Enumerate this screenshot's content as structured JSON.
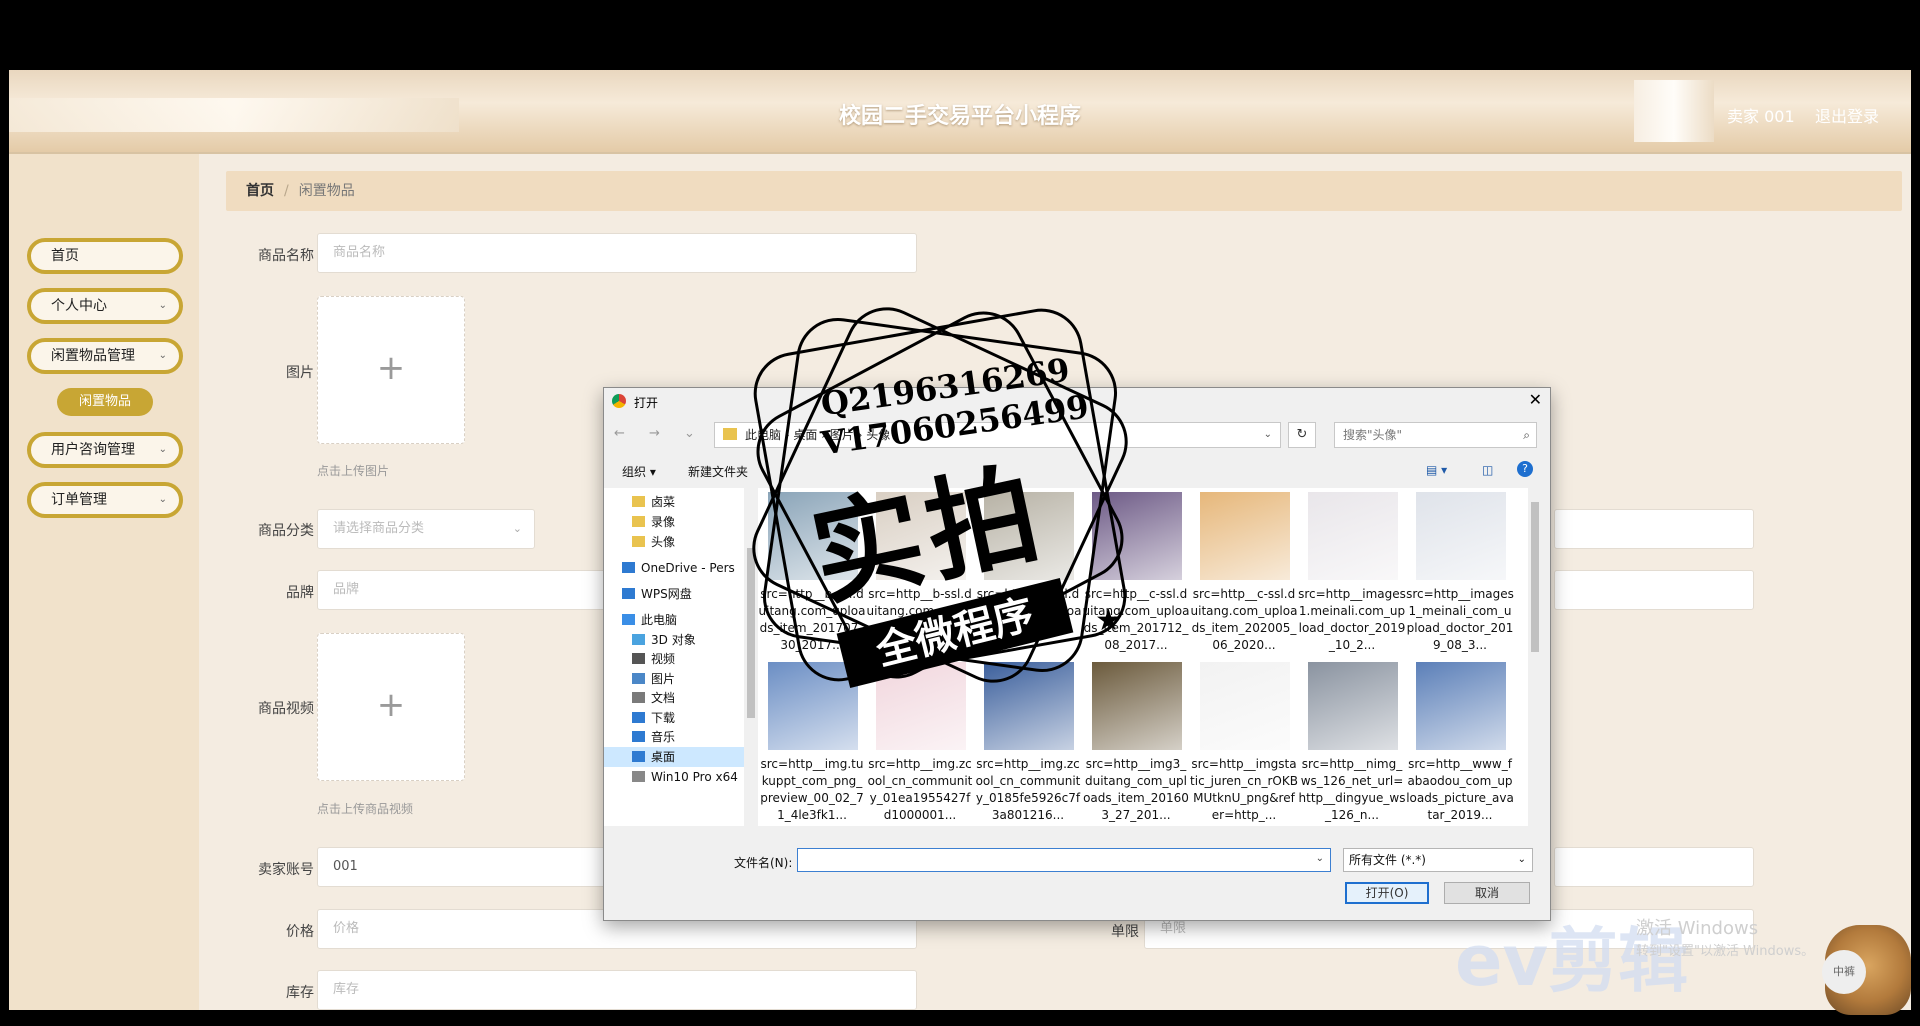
{
  "header": {
    "app_title": "校园二手交易平台小程序",
    "user": "卖家 001",
    "logout": "退出登录"
  },
  "sidebar": {
    "items": [
      {
        "label": "首页",
        "has_chevron": false
      },
      {
        "label": "个人中心",
        "has_chevron": true
      },
      {
        "label": "闲置物品管理",
        "has_chevron": true
      },
      {
        "label": "用户咨询管理",
        "has_chevron": true
      },
      {
        "label": "订单管理",
        "has_chevron": true
      }
    ],
    "active_sub": "闲置物品",
    "chevron": "⌄"
  },
  "breadcrumb": {
    "home": "首页",
    "sep": "/",
    "current": "闲置物品"
  },
  "form": {
    "name_label": "商品名称",
    "name_placeholder": "商品名称",
    "image_label": "图片",
    "image_hint": "点击上传图片",
    "category_label": "商品分类",
    "category_placeholder": "请选择商品分类",
    "brand_label": "品牌",
    "brand_placeholder": "品牌",
    "video_label": "商品视频",
    "video_hint": "点击上传商品视频",
    "seller_label": "卖家账号",
    "seller_value": "001",
    "price_label": "价格",
    "price_placeholder": "价格",
    "limit_label": "单限",
    "limit_placeholder": "单限",
    "stock_label": "库存",
    "stock_placeholder": "库存",
    "plus": "+"
  },
  "dialog": {
    "title": "打开",
    "close": "✕",
    "nav": "← → ⌄ ↑",
    "address": "此电脑 › 桌面 › 图片 › 头像",
    "refresh": "↻",
    "search_placeholder": "搜索\"头像\"",
    "organize": "组织 ▾",
    "new_folder": "新建文件夹",
    "help": "?",
    "tree": [
      {
        "label": "卤菜",
        "icon": "folder-icon"
      },
      {
        "label": "录像",
        "icon": "folder-icon"
      },
      {
        "label": "头像",
        "icon": "folder-icon"
      },
      {
        "label": "OneDrive - Pers",
        "icon": "cloud-icon"
      },
      {
        "label": "WPS网盘",
        "icon": "cloud-icon"
      },
      {
        "label": "此电脑",
        "icon": "pc-icon"
      },
      {
        "label": "3D 对象",
        "icon": "3d-icon"
      },
      {
        "label": "视频",
        "icon": "video-icon"
      },
      {
        "label": "图片",
        "icon": "picture-icon"
      },
      {
        "label": "文档",
        "icon": "document-icon"
      },
      {
        "label": "下载",
        "icon": "download-icon"
      },
      {
        "label": "音乐",
        "icon": "music-icon"
      },
      {
        "label": "桌面",
        "icon": "desktop-icon",
        "selected": true
      },
      {
        "label": "Win10 Pro x64",
        "icon": "drive-icon"
      }
    ],
    "files": [
      {
        "name": "src=http__b-ssl.duitang.com_uploads_item_201707_30_2017...",
        "color": "#8aa4b8"
      },
      {
        "name": "src=http__b-ssl.duitang.com_uploads_item_20...",
        "color": "#d9cfc3"
      },
      {
        "name": "src=http__c-ssl.duitang.com_uploads_item_20...",
        "color": "#b7b2a5"
      },
      {
        "name": "src=http__c-ssl.duitang.com_uploads_item_201712_08_2017...",
        "color": "#6d5a86"
      },
      {
        "name": "src=http__c-ssl.duitang.com_uploads_item_202005_06_2020...",
        "color": "#e6b77a"
      },
      {
        "name": "src=http__images1.meinali.com_upload_doctor_2019_10_2...",
        "color": "#e9e6ea"
      },
      {
        "name": "src=http__images1_meinali_com_upload_doctor_2019_08_3...",
        "color": "#dfe3ea"
      },
      {
        "name": "src=http__img.tukuppt_com_png_preview_00_02_71_4le3fk1...",
        "color": "#6b8ec4"
      },
      {
        "name": "src=http__img.zcool_cn_community_01ea1955427fd1000001...",
        "color": "#f1d6dd"
      },
      {
        "name": "src=http__img.zcool_cn_community_0185fe5926c7f3a801216...",
        "color": "#3b5f9c"
      },
      {
        "name": "src=http__img3_duitang_com_uploads_item_201603_27_201...",
        "color": "#6b5a3c"
      },
      {
        "name": "src=http__imgstatic_juren_cn_rOKBMUtknU_png&refer=http_...",
        "color": "#f2f2f2"
      },
      {
        "name": "src=http__nimg_ws_126_net_url=http__dingyue_ws_126_n...",
        "color": "#8a93a0"
      },
      {
        "name": "src=http__www_fabaodou_com_uploads_picture_avatar_2019...",
        "color": "#5b7fb8"
      }
    ],
    "filename_label": "文件名(N):",
    "filename_value": "",
    "filetype": "所有文件 (*.*)",
    "open_button": "打开(O)",
    "cancel_button": "取消"
  },
  "overlays": {
    "stamp_line1": "Q2196316269",
    "stamp_line2": "V17060256499",
    "stamp_big": "实拍",
    "stamp_band": "全微程序",
    "activate_title": "激活 Windows",
    "activate_sub": "转到\"设置\"以激活 Windows。",
    "ev": "ev剪辑",
    "badge": "中裤"
  }
}
